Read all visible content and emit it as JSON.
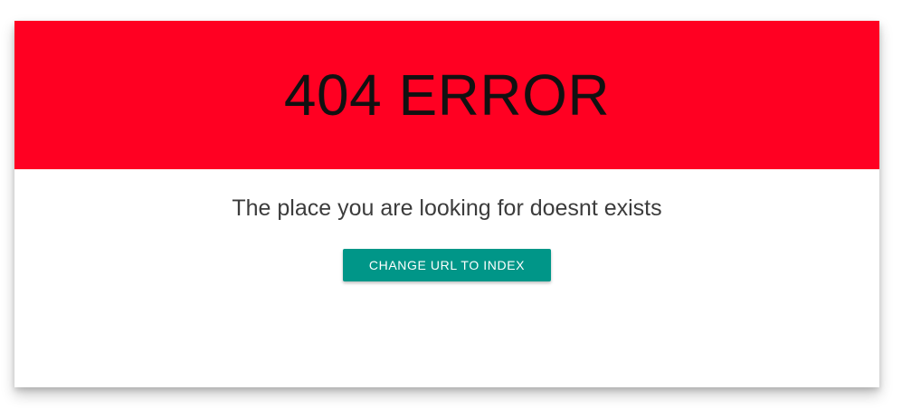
{
  "error": {
    "title": "404 ERROR",
    "message": "The place you are looking for doesnt exists",
    "button_label": "CHANGE URL TO INDEX"
  },
  "colors": {
    "header_background": "#ff0022",
    "button_background": "#009688",
    "title_text": "#111111",
    "message_text": "#3c3c3c"
  }
}
